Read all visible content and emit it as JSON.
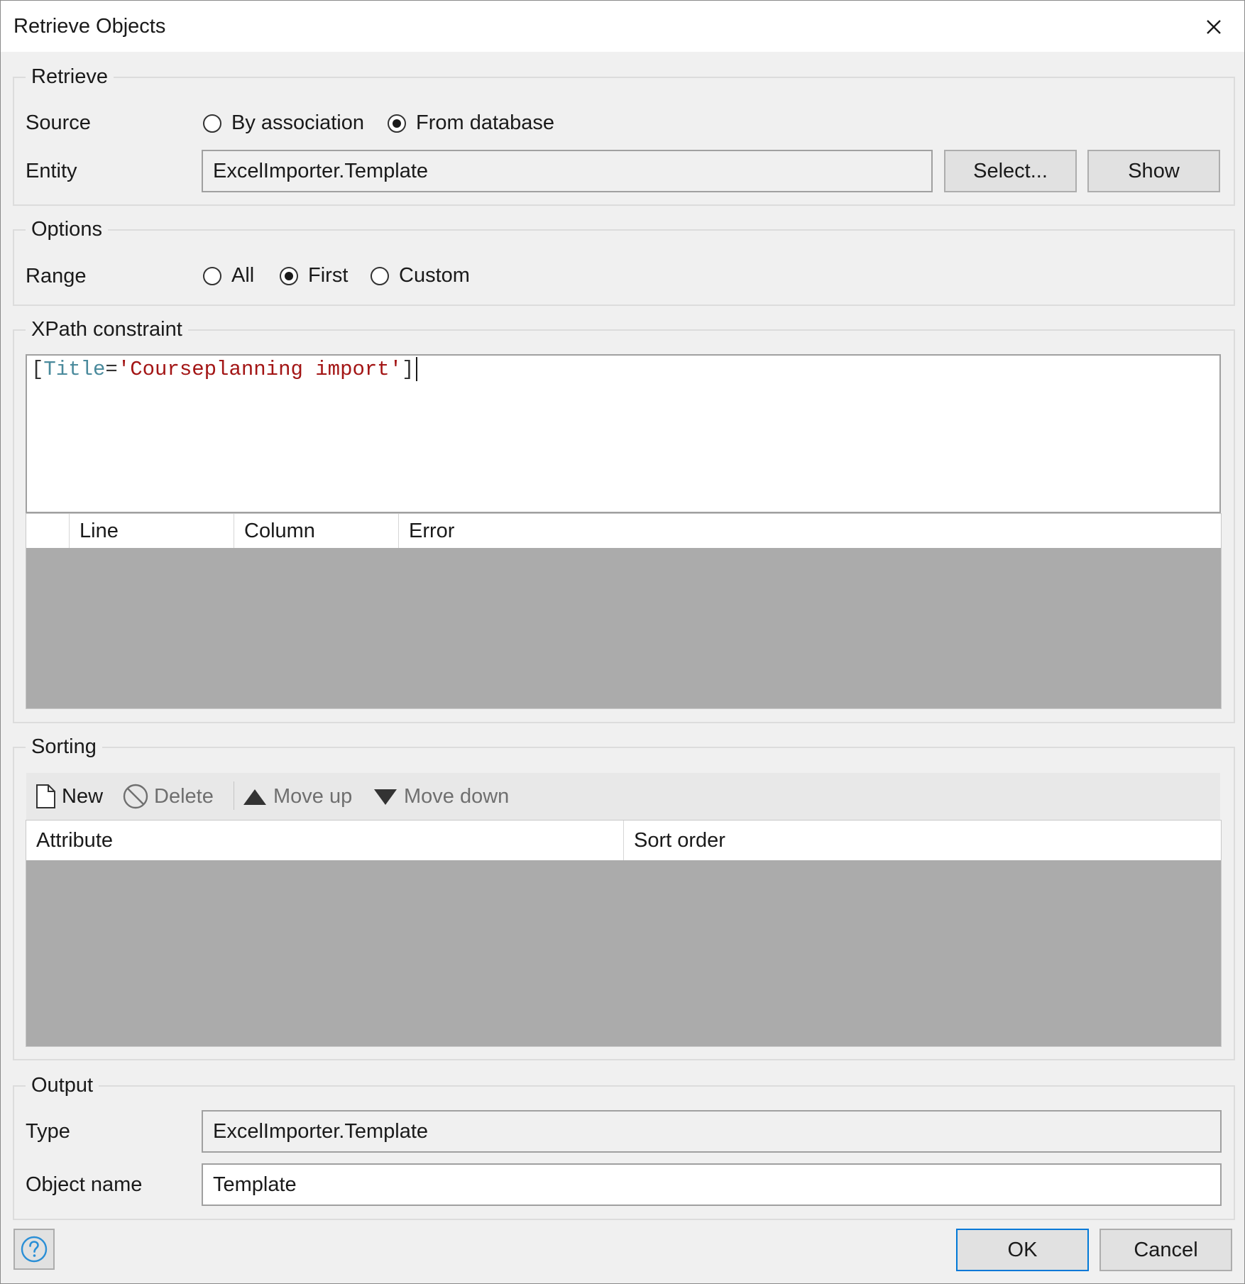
{
  "window": {
    "title": "Retrieve Objects"
  },
  "retrieve": {
    "legend": "Retrieve",
    "source_label": "Source",
    "source_options": [
      {
        "label": "By association",
        "checked": false
      },
      {
        "label": "From database",
        "checked": true
      }
    ],
    "entity_label": "Entity",
    "entity_value": "ExcelImporter.Template",
    "select_button": "Select...",
    "show_button": "Show"
  },
  "options": {
    "legend": "Options",
    "range_label": "Range",
    "range_options": [
      {
        "label": "All",
        "checked": false
      },
      {
        "label": "First",
        "checked": true
      },
      {
        "label": "Custom",
        "checked": false
      }
    ]
  },
  "xpath": {
    "legend": "XPath constraint",
    "text": "[Title='Courseplanning import']",
    "tokens": {
      "open_bracket": "[",
      "attribute": "Title",
      "operator": "=",
      "string": "'Courseplanning import'",
      "close_bracket": "]"
    },
    "errors_grid": {
      "columns": [
        "",
        "Line",
        "Column",
        "Error"
      ],
      "rows": []
    }
  },
  "sorting": {
    "legend": "Sorting",
    "toolbar": {
      "new": "New",
      "delete": "Delete",
      "move_up": "Move up",
      "move_down": "Move down"
    },
    "columns": [
      "Attribute",
      "Sort order"
    ],
    "rows": []
  },
  "output": {
    "legend": "Output",
    "type_label": "Type",
    "type_value": "ExcelImporter.Template",
    "object_name_label": "Object name",
    "object_name_value": "Template"
  },
  "footer": {
    "ok_button": "OK",
    "cancel_button": "Cancel",
    "help_icon": "question-circle-icon"
  },
  "colors": {
    "dialog_bg": "#f0f0f0",
    "grid_empty_bg": "#ababab",
    "xpath_attribute": "#4a8a9c",
    "xpath_string": "#a31515",
    "default_button_border": "#0078d7",
    "help_icon": "#2b8fd6"
  }
}
